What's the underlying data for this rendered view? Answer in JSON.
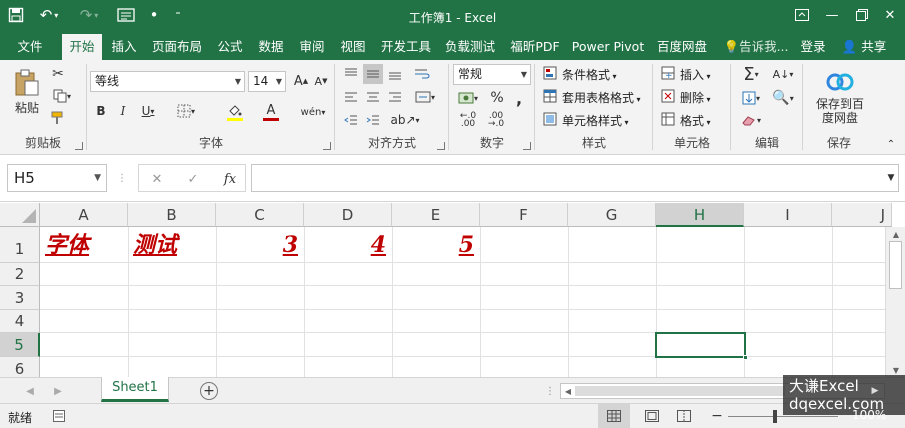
{
  "window": {
    "title": "工作簿1 - Excel"
  },
  "tabs": [
    {
      "label": "文件"
    },
    {
      "label": "开始"
    },
    {
      "label": "插入"
    },
    {
      "label": "页面布局"
    },
    {
      "label": "公式"
    },
    {
      "label": "数据"
    },
    {
      "label": "审阅"
    },
    {
      "label": "视图"
    },
    {
      "label": "开发工具"
    },
    {
      "label": "负载测试"
    },
    {
      "label": "福昕PDF"
    },
    {
      "label": "Power Pivot"
    },
    {
      "label": "百度网盘"
    }
  ],
  "tell_me": "告诉我...",
  "signin": "登录",
  "share": "共享",
  "ribbon": {
    "clipboard": {
      "label": "剪贴板",
      "paste": "粘贴"
    },
    "font": {
      "label": "字体",
      "name": "等线",
      "size": "14"
    },
    "alignment": {
      "label": "对齐方式"
    },
    "number": {
      "label": "数字",
      "format": "常规"
    },
    "styles": {
      "label": "样式",
      "conditional": "条件格式",
      "table": "套用表格格式",
      "cell_styles": "单元格样式"
    },
    "cells": {
      "label": "单元格",
      "insert": "插入",
      "delete": "删除",
      "format": "格式"
    },
    "editing": {
      "label": "编辑"
    },
    "save": {
      "label": "保存",
      "button": "保存到百度网盘"
    }
  },
  "formula_bar": {
    "name_box": "H5",
    "fx": "fx",
    "formula": ""
  },
  "grid": {
    "columns": [
      "A",
      "B",
      "C",
      "D",
      "E",
      "F",
      "G",
      "H",
      "I",
      "J"
    ],
    "rows": [
      "1",
      "2",
      "3",
      "4",
      "5",
      "6"
    ],
    "selected_cell": "H5",
    "row1": {
      "A": "字体",
      "B": "测试",
      "C": "3",
      "D": "4",
      "E": "5"
    },
    "text_color": "#c00000"
  },
  "sheets": [
    {
      "label": "Sheet1"
    }
  ],
  "status": {
    "ready": "就绪",
    "zoom": "100%"
  },
  "watermark": {
    "line1": "大谦Excel",
    "line2": "dqexcel.com"
  },
  "colors": {
    "accent": "#217346"
  }
}
